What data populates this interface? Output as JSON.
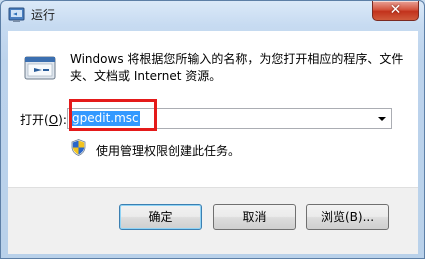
{
  "window": {
    "title": "运行",
    "close_label": "✕"
  },
  "main": {
    "description": "Windows 将根据您所输入的名称，为您打开相应的程序、文件夹、文档或 Internet 资源。",
    "open_label_prefix": "打开(",
    "open_label_key": "O",
    "open_label_suffix": "):",
    "command_value": "gpedit.msc",
    "admin_note": "使用管理权限创建此任务。"
  },
  "buttons": {
    "ok": "确定",
    "cancel": "取消",
    "browse": "浏览(B)..."
  },
  "colors": {
    "highlight_border": "#e41a1a",
    "selection": "#3399ff"
  }
}
